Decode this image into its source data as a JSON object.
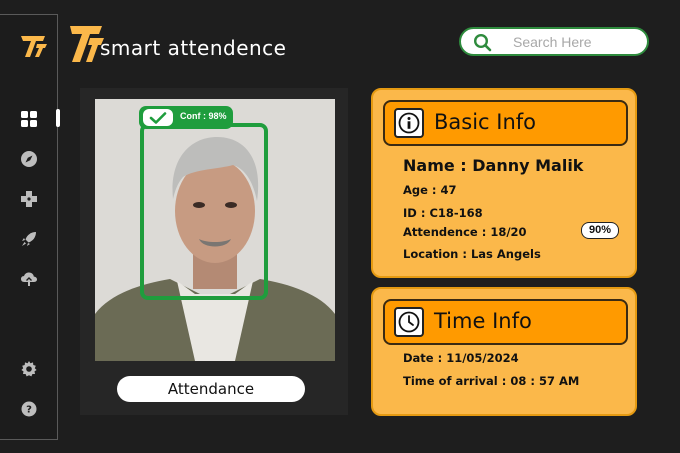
{
  "app": {
    "title": "smart attendence",
    "logo_letter": "T",
    "accent_color": "#fbb84a",
    "accent_orange": "#ff9a00",
    "success_color": "#1f9d3d"
  },
  "sidebar": {
    "items": [
      {
        "icon": "dashboard-grid-icon",
        "active": true
      },
      {
        "icon": "compass-icon",
        "active": false
      },
      {
        "icon": "gamepad-icon",
        "active": false
      },
      {
        "icon": "rocket-icon",
        "active": false
      },
      {
        "icon": "cloud-upload-icon",
        "active": false
      },
      {
        "icon": "gear-icon",
        "active": false
      },
      {
        "icon": "help-icon",
        "active": false
      }
    ]
  },
  "search": {
    "placeholder": "Search Here",
    "icon": "search-icon"
  },
  "camera": {
    "confidence_label": "Conf : 98%",
    "button_label": "Attendance"
  },
  "basic_info": {
    "title": "Basic Info",
    "icon": "info-icon",
    "name_label": "Name : ",
    "name_value": "Danny Malik",
    "age_label": "Age : ",
    "age_value": "47",
    "id_label": "ID : ",
    "id_value": "C18-168",
    "attendence_label": "Attendence : ",
    "attendence_value": "18/20",
    "attendence_percent": "90%",
    "location_label": "Location : ",
    "location_value": "Las Angels"
  },
  "time_info": {
    "title": "Time Info",
    "icon": "clock-icon",
    "date_label": "Date : ",
    "date_value": "11/05/2024",
    "arrival_label": "Time of arrival : ",
    "arrival_value": "08 : 57 AM"
  }
}
